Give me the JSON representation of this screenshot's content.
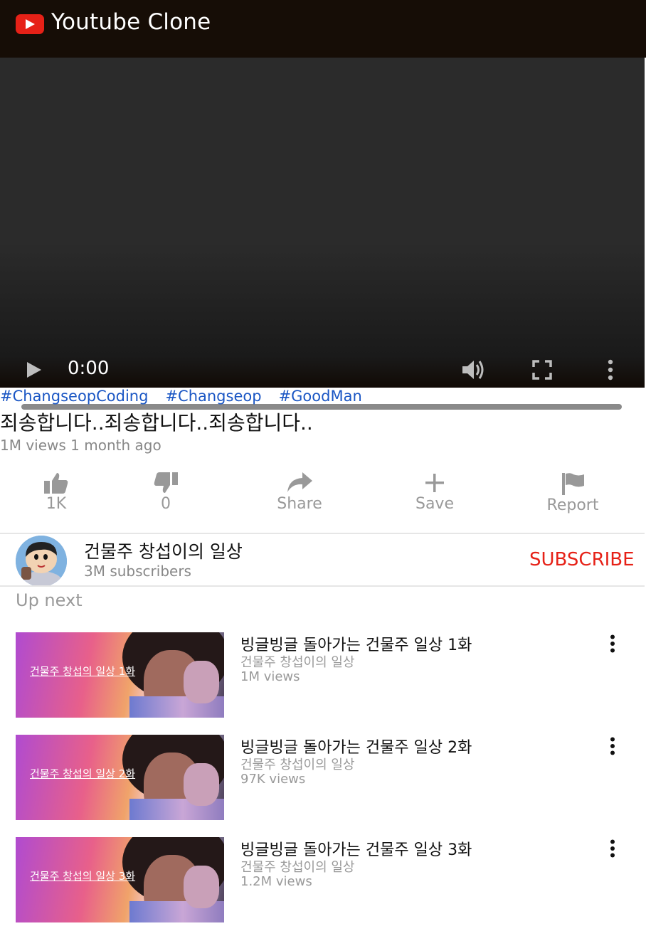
{
  "header": {
    "app_title": "Youtube Clone",
    "logo_icon": "youtube-play-icon",
    "logo_color": "#e62117"
  },
  "player": {
    "time": "0:00",
    "progress": 0,
    "controls": [
      "play-icon",
      "volume-icon",
      "fullscreen-icon",
      "more-vert-icon"
    ]
  },
  "video": {
    "hashtags": [
      "#ChangseopCoding",
      "#Changseop",
      "#GoodMan"
    ],
    "title": "죄송합니다..죄송합니다..죄송합니다..",
    "views": "1M views",
    "age": "1 month ago"
  },
  "actions": {
    "like_count": "1K",
    "dislike_count": "0",
    "share_label": "Share",
    "save_label": "Save",
    "report_label": "Report"
  },
  "channel": {
    "name": "건물주 창섭이의 일상",
    "subscribers": "3M subscribers",
    "subscribe_label": "SUBSCRIBE",
    "subscribe_color": "#e62117"
  },
  "up_next": {
    "heading": "Up next",
    "items": [
      {
        "title": "빙글빙글 돌아가는 건물주 일상 1화",
        "channel": "건물주 창섭이의 일상",
        "views": "1M views",
        "thumb_text": "건물주 창섭의 일상 1화"
      },
      {
        "title": "빙글빙글 돌아가는 건물주 일상 2화",
        "channel": "건물주 창섭이의 일상",
        "views": "97K views",
        "thumb_text": "건물주 창섭의 일상 2화"
      },
      {
        "title": "빙글빙글 돌아가는 건물주 일상 3화",
        "channel": "건물주 창섭이의 일상",
        "views": "1.2M views",
        "thumb_text": "건물주 창섭의 일상 3화"
      }
    ]
  }
}
